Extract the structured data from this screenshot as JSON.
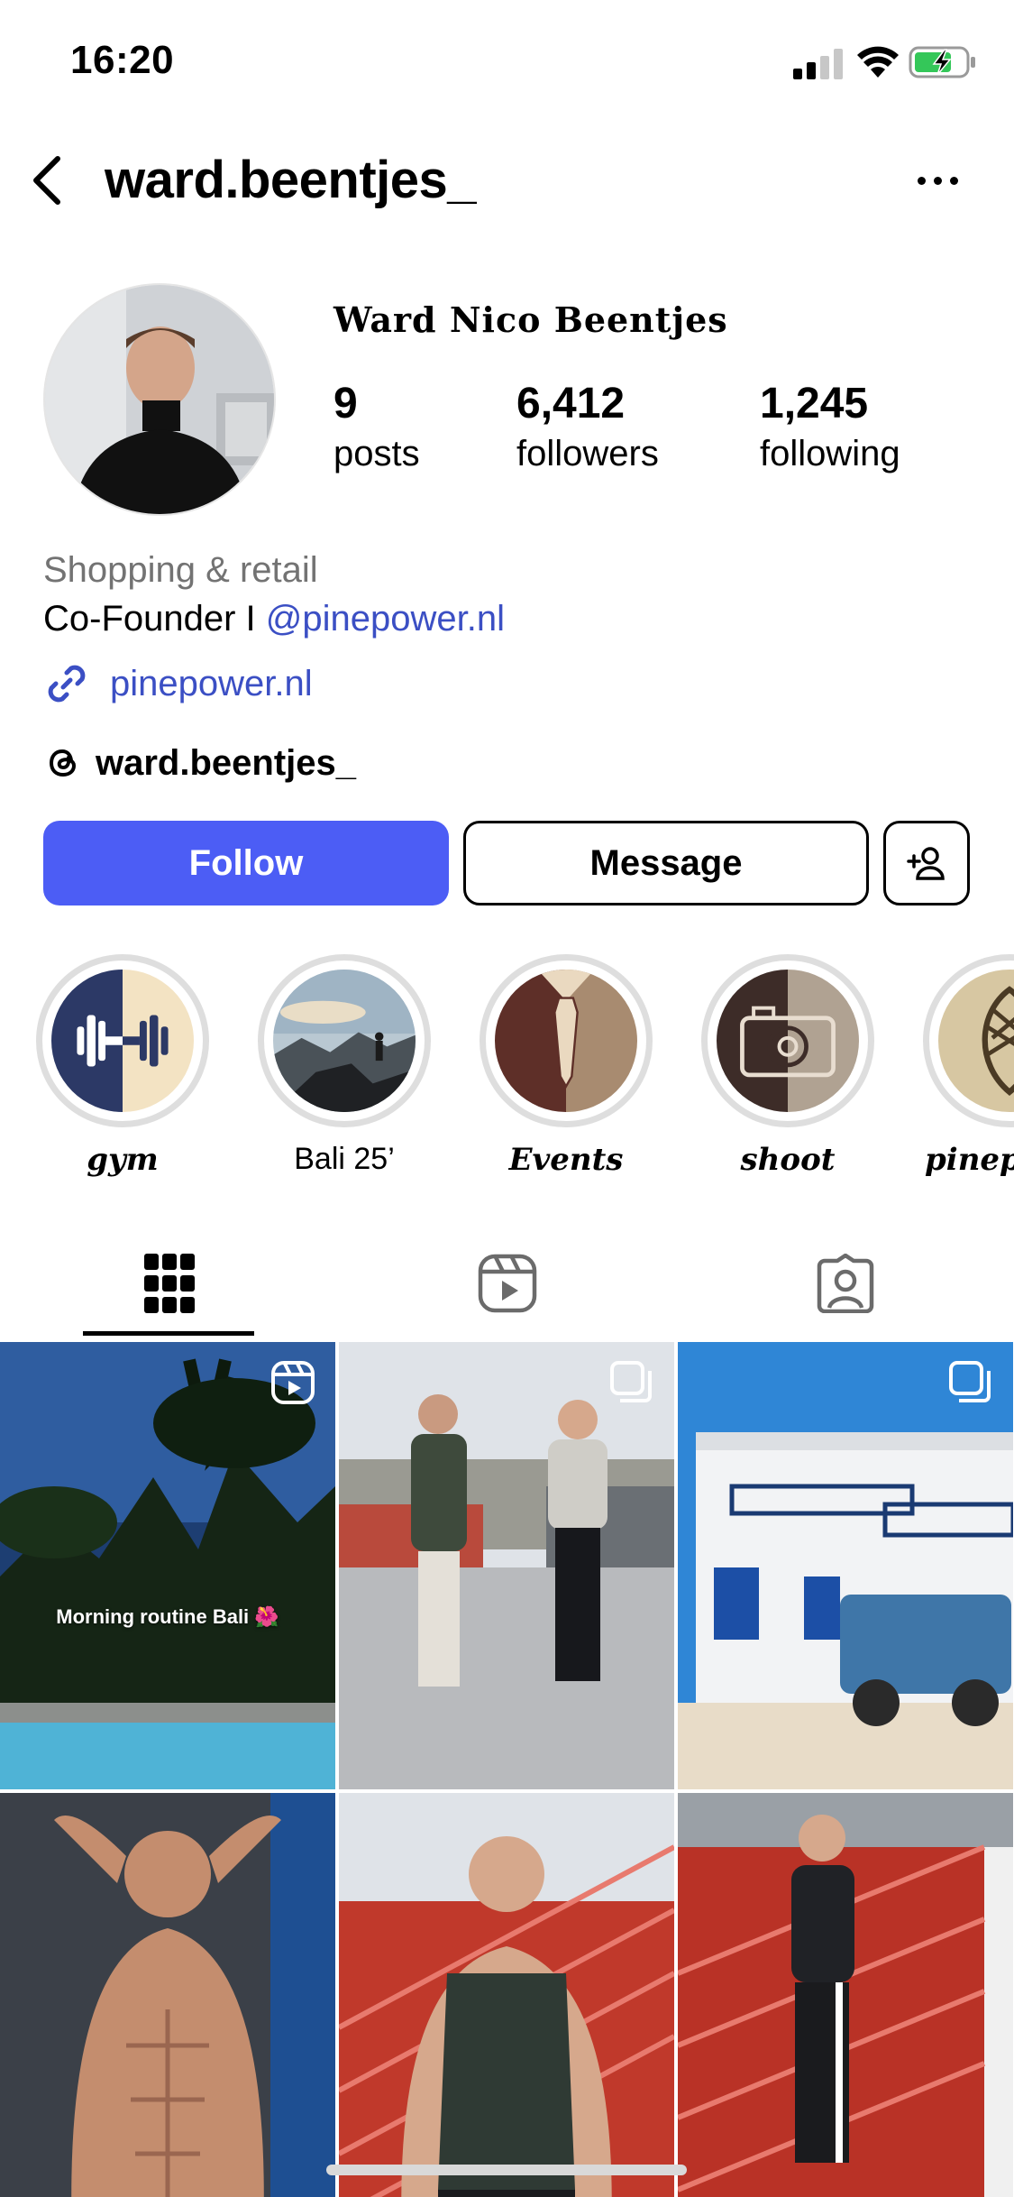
{
  "status_bar": {
    "time": "16:20"
  },
  "header": {
    "username": "ward.beentjes_"
  },
  "profile": {
    "display_name": "Ward Nico Beentjes",
    "stats": [
      {
        "value": "9",
        "label": "posts"
      },
      {
        "value": "6,412",
        "label": "followers"
      },
      {
        "value": "1,245",
        "label": "following"
      }
    ],
    "category": "Shopping & retail",
    "bio_prefix": "Co-Founder I ",
    "bio_mention": "@pinepower.nl",
    "link": "pinepower.nl",
    "threads_handle": "ward.beentjes_"
  },
  "actions": {
    "follow": "Follow",
    "message": "Message"
  },
  "highlights": [
    {
      "label": "gym",
      "icon": "dumbbell-icon"
    },
    {
      "label": "Bali 25’",
      "icon": "mountain-photo"
    },
    {
      "label": "Events",
      "icon": "tie-icon"
    },
    {
      "label": "shoot",
      "icon": "camera-icon"
    },
    {
      "label": "pinep",
      "icon": "pinecone-icon"
    }
  ],
  "tabs": [
    {
      "name": "posts-grid",
      "icon": "grid-icon",
      "active": true
    },
    {
      "name": "reels",
      "icon": "reels-icon",
      "active": false
    },
    {
      "name": "tagged",
      "icon": "tagged-icon",
      "active": false
    }
  ],
  "grid": {
    "posts": [
      {
        "caption": "Morning routine Bali 🌺",
        "badge": "reel-icon"
      },
      {
        "caption": "",
        "badge": "carousel-icon"
      },
      {
        "caption": "",
        "badge": "carousel-icon"
      },
      {
        "caption": "",
        "badge": ""
      },
      {
        "caption": "",
        "badge": ""
      },
      {
        "caption": "",
        "badge": ""
      }
    ]
  },
  "colors": {
    "accent": "#4c5df5",
    "link": "#3b4fc4",
    "secondary_text": "#737373",
    "highlight_ring": "#dedede"
  }
}
